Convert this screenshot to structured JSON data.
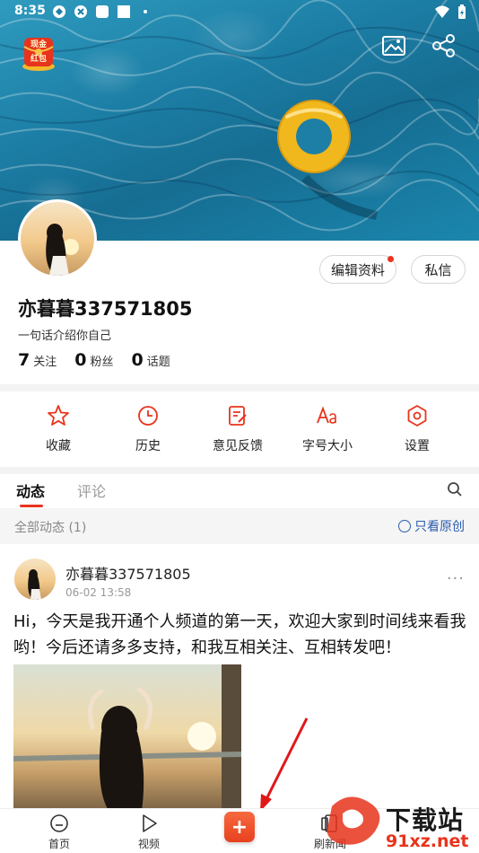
{
  "status_bar": {
    "time": "8:35"
  },
  "header": {
    "hongbao_label_top": "现金",
    "hongbao_label_bottom": "红包"
  },
  "profile": {
    "edit_button": "编辑资料",
    "message_button": "私信",
    "username": "亦暮暮337571805",
    "bio": "一句话介绍你自己",
    "stats": [
      {
        "num": "7",
        "label": "关注"
      },
      {
        "num": "0",
        "label": "粉丝"
      },
      {
        "num": "0",
        "label": "话题"
      }
    ]
  },
  "quick_actions": [
    {
      "label": "收藏",
      "icon": "star-icon"
    },
    {
      "label": "历史",
      "icon": "clock-icon"
    },
    {
      "label": "意见反馈",
      "icon": "feedback-icon"
    },
    {
      "label": "字号大小",
      "icon": "font-size-icon"
    },
    {
      "label": "设置",
      "icon": "gear-icon"
    }
  ],
  "tabs": {
    "active": "动态",
    "second": "评论"
  },
  "filter": {
    "left": "全部动态 (1)",
    "right": "只看原创"
  },
  "post": {
    "author": "亦暮暮337571805",
    "time": "06-02 13:58",
    "more": "···",
    "text": "Hi，今天是我开通个人频道的第一天，欢迎大家到时间线来看我哟！今后还请多多支持，和我互相关注、互相转发吧！"
  },
  "bottom_nav": {
    "home": "首页",
    "video": "视频",
    "fab": "+",
    "refresh": "刷新闻"
  },
  "watermark": {
    "line1": "下载站",
    "line2": "91xz.net"
  },
  "colors": {
    "accent": "#e8341c",
    "link": "#2a5db0",
    "ring_yellow": "#f0b81c"
  }
}
